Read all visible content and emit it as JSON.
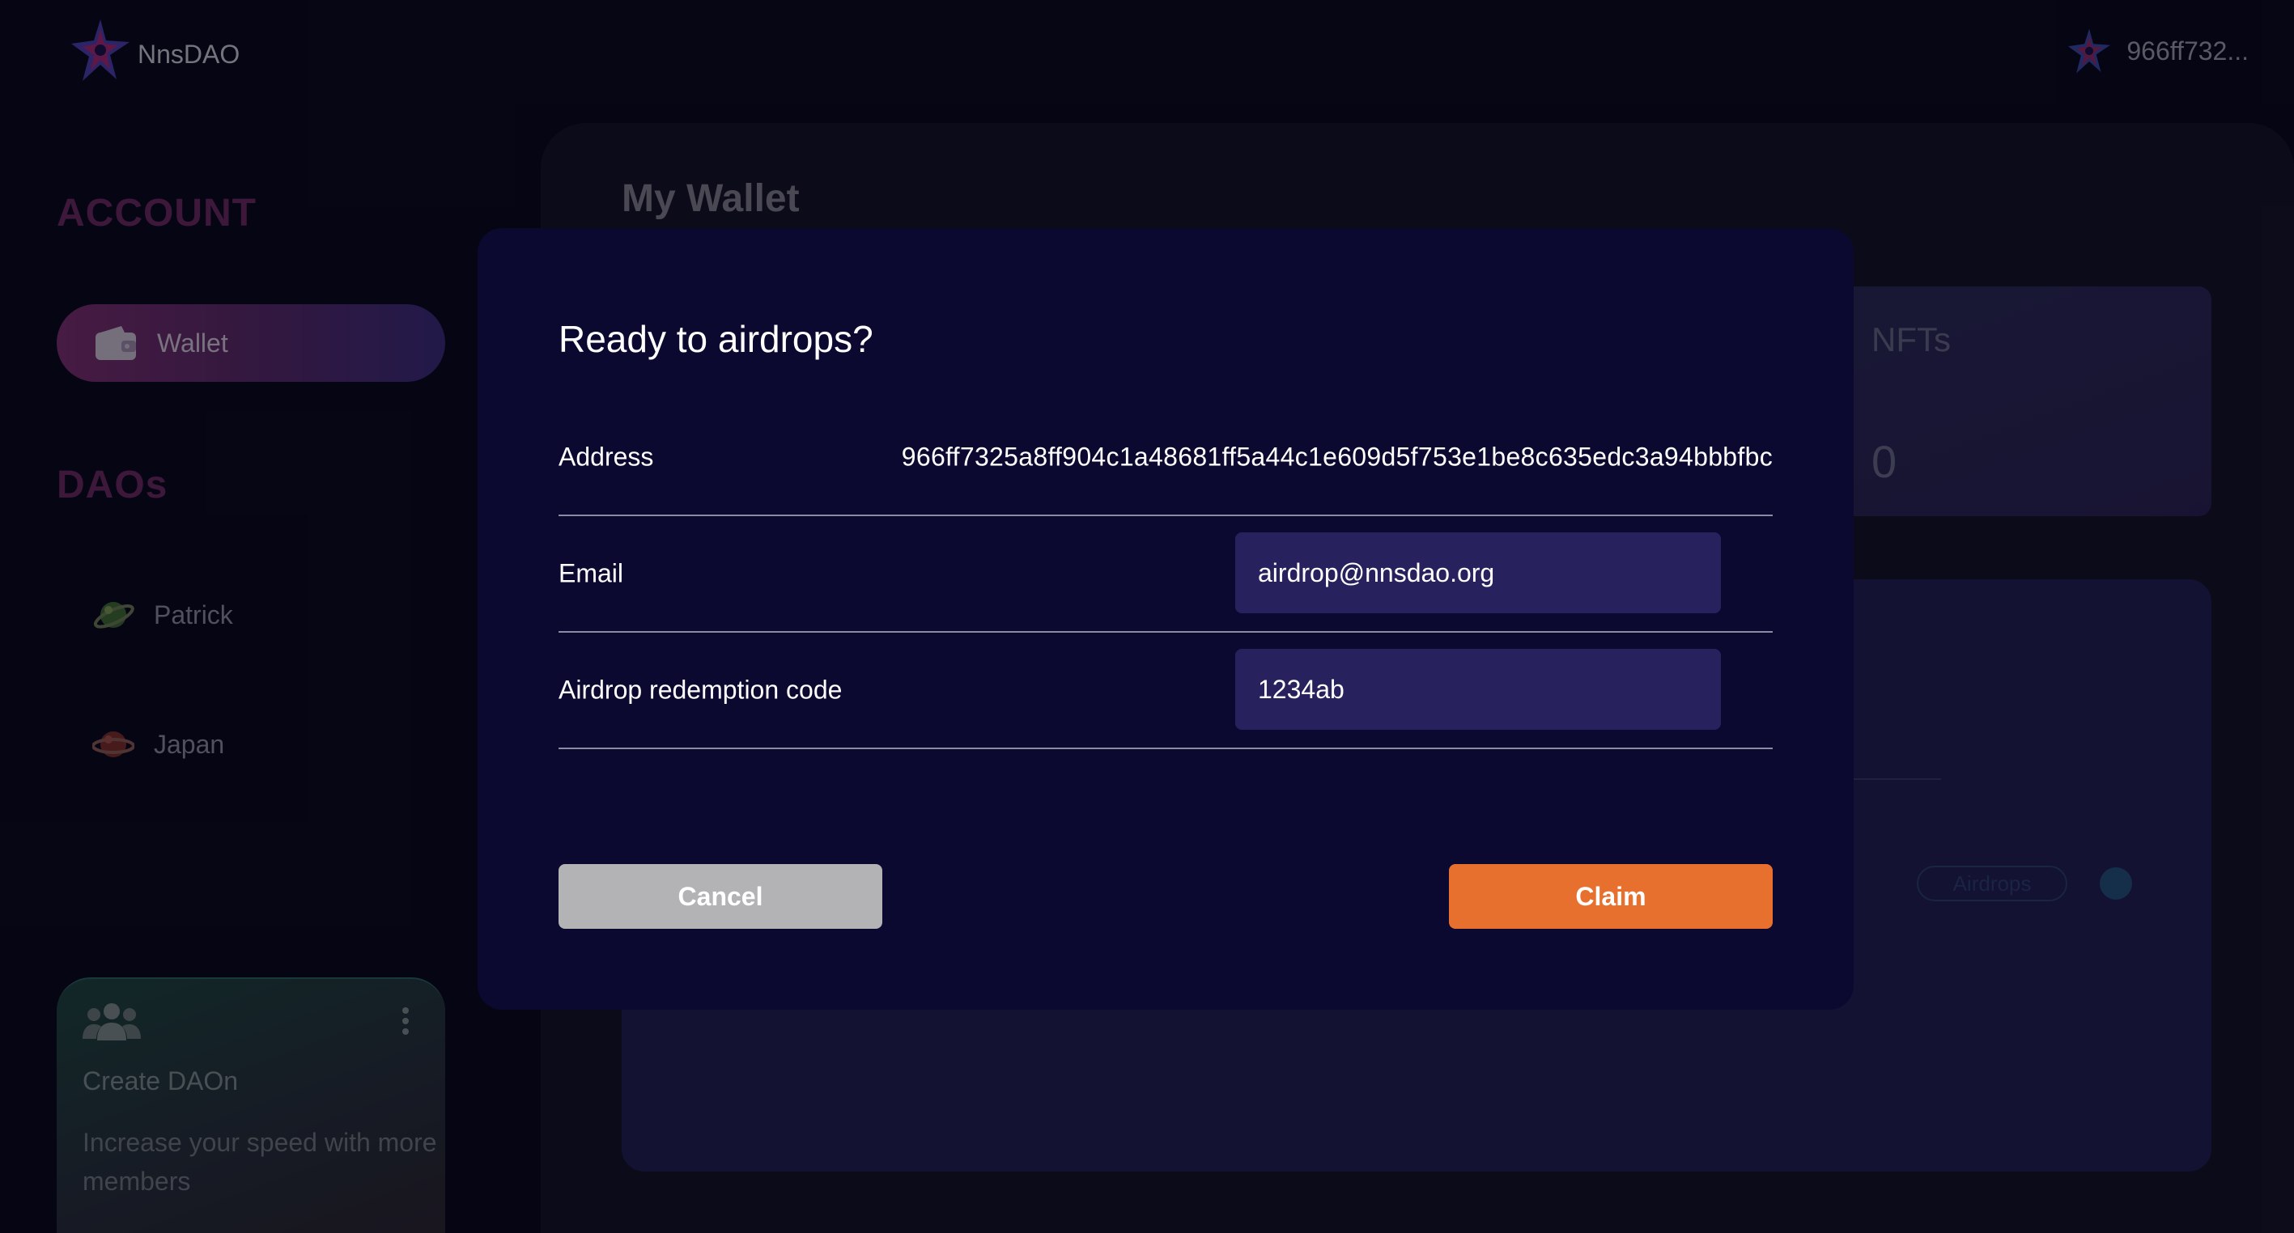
{
  "app": {
    "name": "NnsDAO",
    "account_short": "966ff732..."
  },
  "sidebar": {
    "account_heading": "ACCOUNT",
    "wallet_label": "Wallet",
    "daos_heading": "DAOs",
    "daos": [
      {
        "label": "Patrick",
        "icon": "green-planet-icon"
      },
      {
        "label": "Japan",
        "icon": "red-planet-icon"
      }
    ],
    "create_card": {
      "title": "Create DAOn",
      "description": "Increase your speed with more members"
    }
  },
  "main": {
    "title": "My Wallet",
    "stat_card": {
      "label": "NFTs",
      "value": "0"
    },
    "tags": [
      "Airdrops"
    ]
  },
  "modal": {
    "title": "Ready to airdrops?",
    "address_label": "Address",
    "address_value": "966ff7325a8ff904c1a48681ff5a44c1e609d5f753e1be8c635edc3a94bbbfbc",
    "email_label": "Email",
    "email_value": "airdrop@nnsdao.org",
    "code_label": "Airdrop redemption code",
    "code_value": "1234ab",
    "cancel_label": "Cancel",
    "claim_label": "Claim"
  },
  "colors": {
    "background": "#0b0a24",
    "modal": "#0b0930",
    "input": "#27225e",
    "accent_orange": "#e8702e",
    "cancel_gray": "#b3b3b6",
    "heading_magenta": "#6a2a66"
  }
}
